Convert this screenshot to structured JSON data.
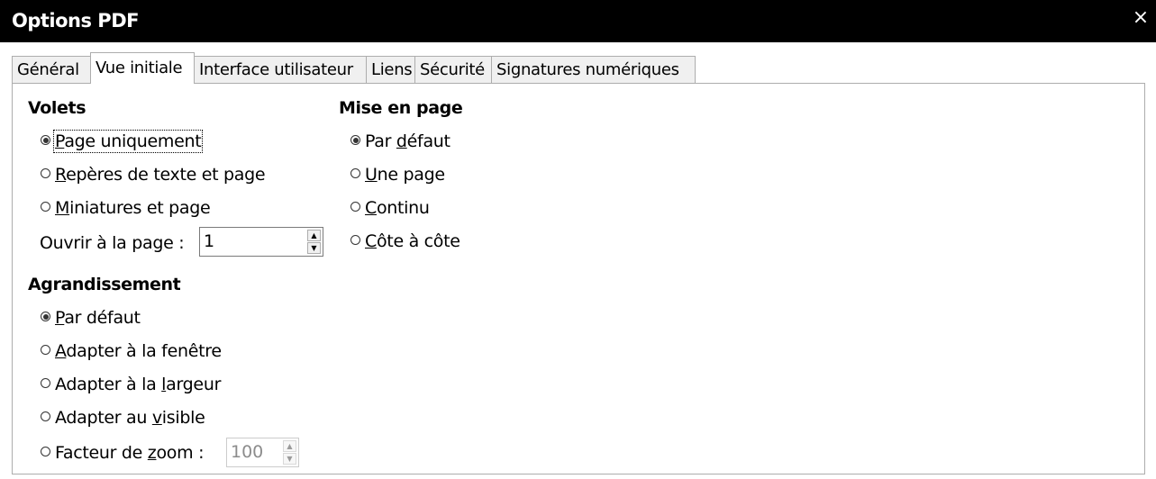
{
  "window": {
    "title": "Options PDF",
    "close_icon": "×"
  },
  "tabs": [
    {
      "label": "Général"
    },
    {
      "label": "Vue initiale"
    },
    {
      "label": "Interface utilisateur"
    },
    {
      "label": "Liens"
    },
    {
      "label": "Sécurité"
    },
    {
      "label": "Signatures numériques"
    }
  ],
  "active_tab": "Vue initiale",
  "volets": {
    "heading": "Volets",
    "options": [
      {
        "pre": "",
        "mnemonic": "P",
        "post": "age uniquement",
        "checked": true
      },
      {
        "pre": "",
        "mnemonic": "R",
        "post": "epères de texte et page",
        "checked": false
      },
      {
        "pre": "",
        "mnemonic": "M",
        "post": "iniatures et page",
        "checked": false
      }
    ],
    "open_page": {
      "pre": "Ouvrir à la pa",
      "mnemonic": "g",
      "post": "e :",
      "value": "1"
    }
  },
  "agrandissement": {
    "heading": "Agrandissement",
    "options": [
      {
        "pre": "",
        "mnemonic": "P",
        "post": "ar défaut",
        "checked": true
      },
      {
        "pre": "",
        "mnemonic": "A",
        "post": "dapter à la fenêtre",
        "checked": false
      },
      {
        "pre": "Adapter à la ",
        "mnemonic": "l",
        "post": "argeur",
        "checked": false
      },
      {
        "pre": "Adapter au ",
        "mnemonic": "v",
        "post": "isible",
        "checked": false
      },
      {
        "pre": "Facteur de ",
        "mnemonic": "z",
        "post": "oom :",
        "checked": false
      }
    ],
    "zoom_value": "100"
  },
  "mise_en_page": {
    "heading": "Mise en page",
    "options": [
      {
        "pre": "Par ",
        "mnemonic": "d",
        "post": "éfaut",
        "checked": true
      },
      {
        "pre": "",
        "mnemonic": "U",
        "post": "ne page",
        "checked": false
      },
      {
        "pre": "",
        "mnemonic": "C",
        "post": "ontinu",
        "checked": false
      },
      {
        "pre": "",
        "mnemonic": "C",
        "post": "ôte à côte",
        "checked": false
      }
    ]
  },
  "spin_arrows": {
    "up": "▲",
    "down": "▼"
  }
}
